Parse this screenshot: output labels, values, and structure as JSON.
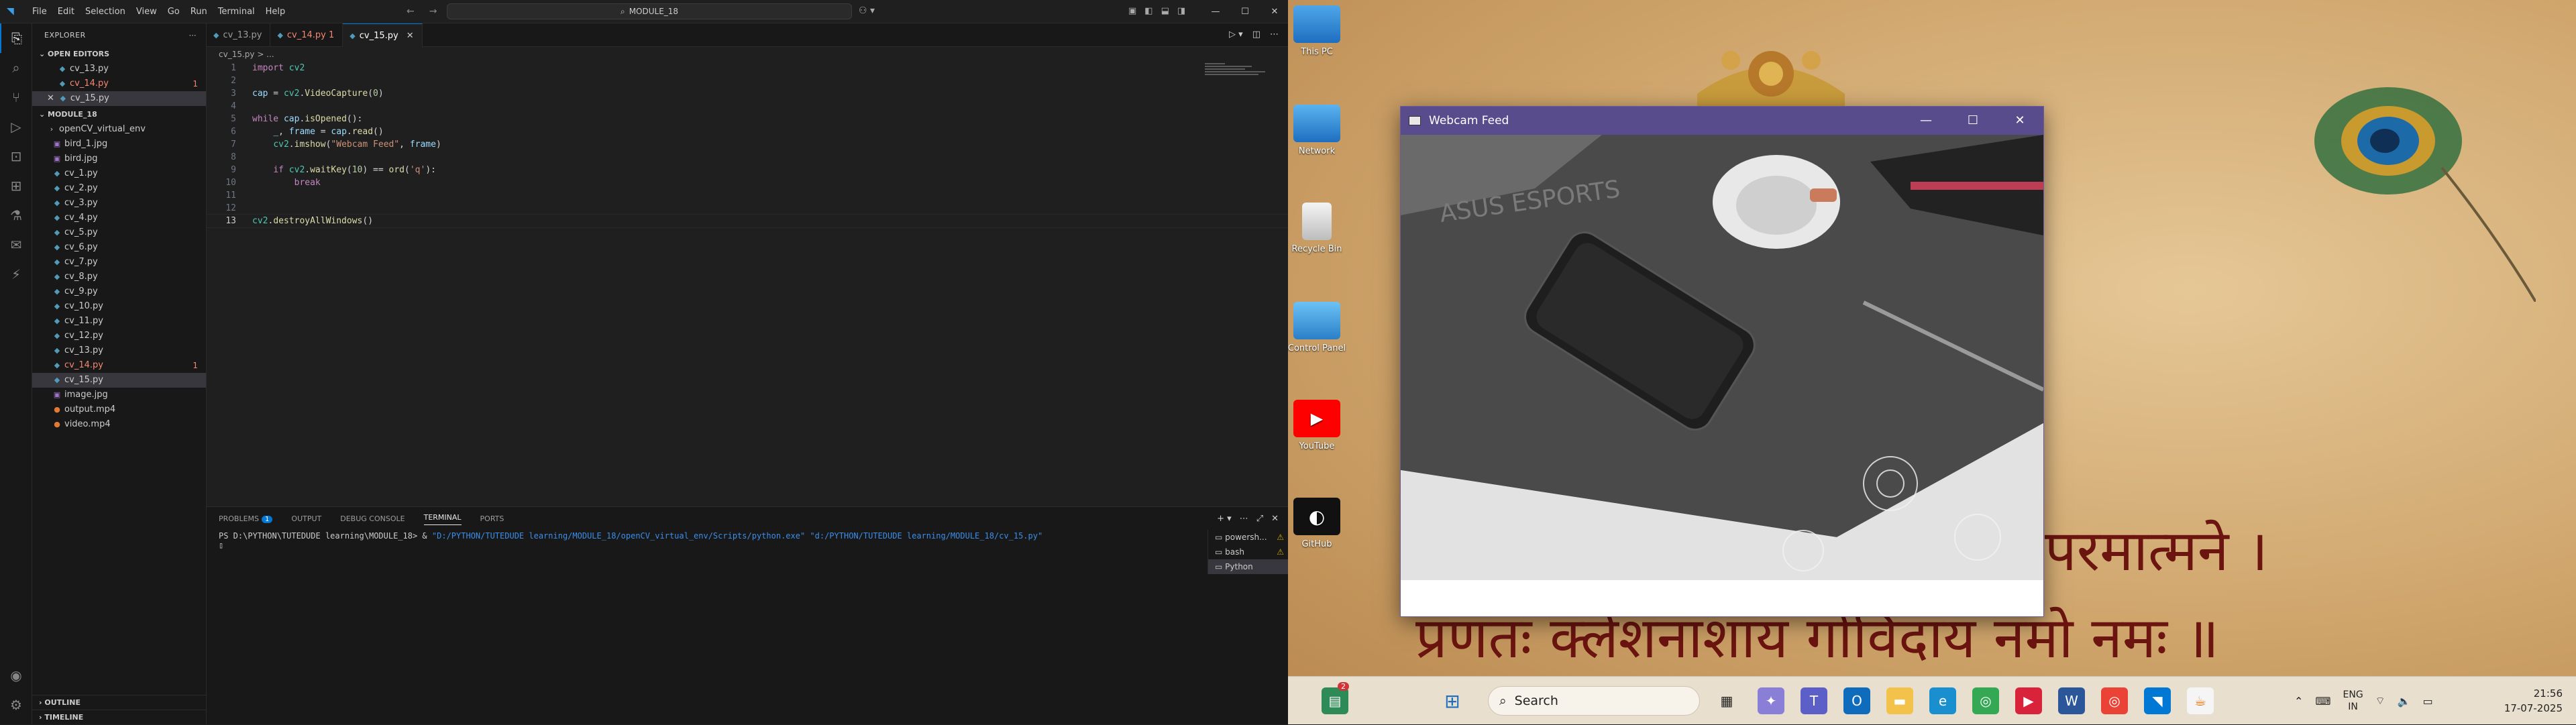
{
  "vscode": {
    "menu": [
      "File",
      "Edit",
      "Selection",
      "View",
      "Go",
      "Run",
      "Terminal",
      "Help"
    ],
    "command_center": "MODULE_18",
    "explorer_title": "EXPLORER",
    "open_editors_label": "OPEN EDITORS",
    "open_editors": [
      {
        "name": "cv_13.py",
        "error": false,
        "count": ""
      },
      {
        "name": "cv_14.py",
        "error": true,
        "count": "1"
      },
      {
        "name": "cv_15.py",
        "error": false,
        "count": "",
        "active": true
      }
    ],
    "folder_label": "MODULE_18",
    "files": [
      {
        "name": "openCV_virtual_env",
        "type": "folder"
      },
      {
        "name": "bird_1.jpg",
        "type": "img"
      },
      {
        "name": "bird.jpg",
        "type": "img"
      },
      {
        "name": "cv_1.py",
        "type": "py"
      },
      {
        "name": "cv_2.py",
        "type": "py"
      },
      {
        "name": "cv_3.py",
        "type": "py"
      },
      {
        "name": "cv_4.py",
        "type": "py"
      },
      {
        "name": "cv_5.py",
        "type": "py"
      },
      {
        "name": "cv_6.py",
        "type": "py"
      },
      {
        "name": "cv_7.py",
        "type": "py"
      },
      {
        "name": "cv_8.py",
        "type": "py"
      },
      {
        "name": "cv_9.py",
        "type": "py"
      },
      {
        "name": "cv_10.py",
        "type": "py"
      },
      {
        "name": "cv_11.py",
        "type": "py"
      },
      {
        "name": "cv_12.py",
        "type": "py"
      },
      {
        "name": "cv_13.py",
        "type": "py"
      },
      {
        "name": "cv_14.py",
        "type": "py",
        "error": true,
        "count": "1"
      },
      {
        "name": "cv_15.py",
        "type": "py",
        "selected": true
      },
      {
        "name": "image.jpg",
        "type": "img"
      },
      {
        "name": "output.mp4",
        "type": "vid"
      },
      {
        "name": "video.mp4",
        "type": "vid"
      }
    ],
    "outline_label": "OUTLINE",
    "timeline_label": "TIMELINE",
    "tabs": [
      {
        "name": "cv_13.py",
        "error": false,
        "count": ""
      },
      {
        "name": "cv_14.py",
        "error": true,
        "count": "1"
      },
      {
        "name": "cv_15.py",
        "error": false,
        "count": "",
        "active": true
      }
    ],
    "breadcrumb": "cv_15.py > ...",
    "code_lines": [
      "import cv2",
      "",
      "cap = cv2.VideoCapture(0)",
      "",
      "while cap.isOpened():",
      "    _, frame = cap.read()",
      "    cv2.imshow(\"Webcam Feed\", frame)",
      "",
      "    if cv2.waitKey(10) == ord('q'):",
      "        break",
      "",
      "",
      "cv2.destroyAllWindows()"
    ],
    "panel_tabs": [
      "PROBLEMS",
      "OUTPUT",
      "DEBUG CONSOLE",
      "TERMINAL",
      "PORTS"
    ],
    "problems_count": "1",
    "terminal_prompt": "PS D:\\PYTHON\\TUTEDUDE learning\\MODULE_18> & ",
    "terminal_cmd1": "\"D:/PYTHON/TUTEDUDE learning/MODULE_18/openCV_virtual_env/Scripts/python.exe\"",
    "terminal_cmd2": " \"d:/PYTHON/TUTEDUDE learning/MODULE_18/cv_15.py\"",
    "terminals": [
      {
        "name": "powersh...",
        "warn": true
      },
      {
        "name": "bash",
        "warn": true
      },
      {
        "name": "Python",
        "warn": false,
        "selected": true
      }
    ]
  },
  "desktop": {
    "icons": [
      "This PC",
      "Network",
      "Recycle Bin",
      "Control Panel",
      "YouTube",
      "GitHub"
    ],
    "sanskrit_line1": "परमात्मने ।",
    "sanskrit_line2": "प्रणतः क्लेशनाशाय गोविंदाय नमो नमः ॥"
  },
  "webcam": {
    "title": "Webcam Feed",
    "frame_text": "ASUS ESPORTS"
  },
  "taskbar": {
    "search_placeholder": "Search",
    "lang_1": "ENG",
    "lang_2": "IN",
    "time": "21:56",
    "date": "17-07-2025",
    "badge_count": "2"
  }
}
